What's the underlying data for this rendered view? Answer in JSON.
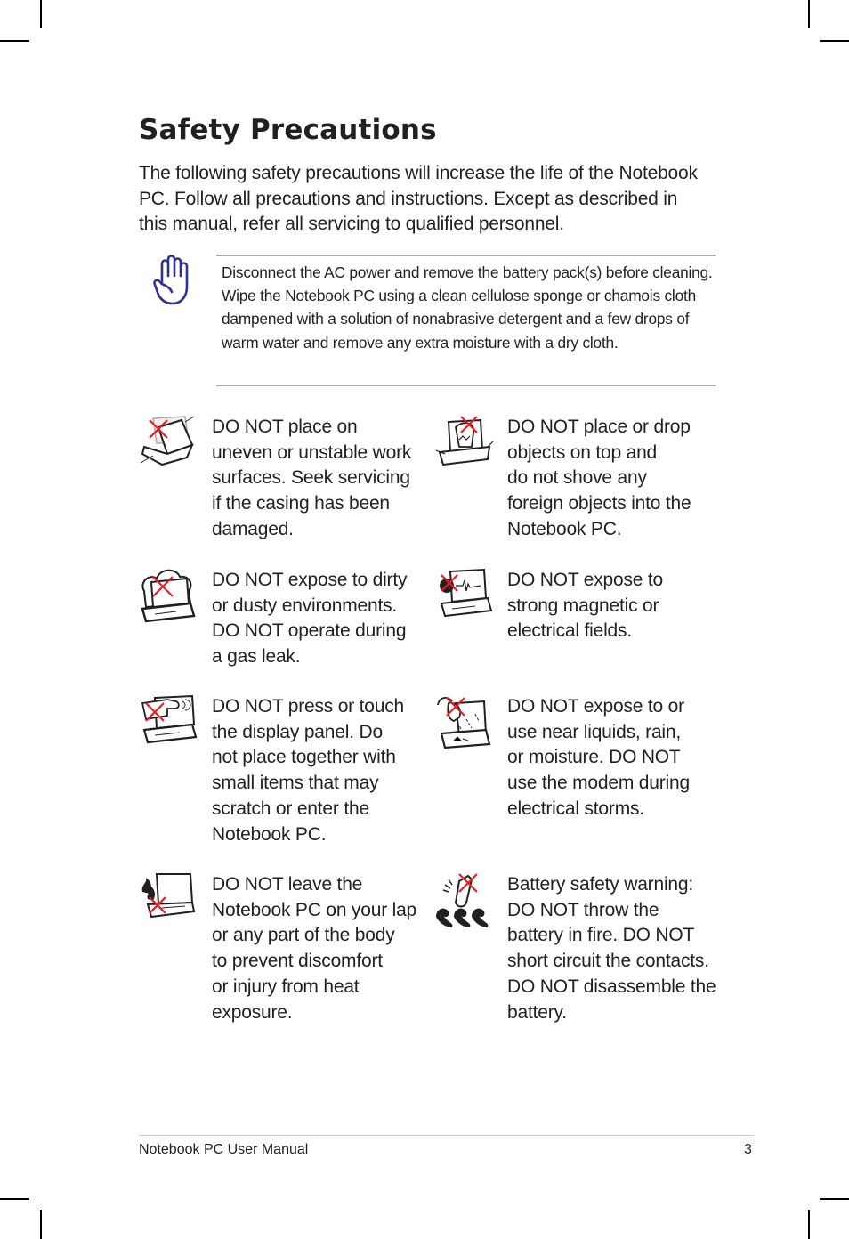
{
  "page": {
    "title": "Safety Precautions",
    "intro": "The following safety precautions will increase the life of the Notebook PC. Follow all precautions and instructions. Except as described in this manual, refer all servicing to qualified personnel.",
    "note": {
      "icon": "raised-hand-icon",
      "text": "Disconnect the AC power and remove the battery pack(s) before cleaning. Wipe the Notebook PC using a clean cellulose sponge or chamois cloth dampened with a solution of nonabrasive detergent and a few drops of warm water and remove any extra moisture with a dry cloth."
    },
    "precautions": [
      {
        "icon": "unstable-surface-icon",
        "text": "DO NOT place on\nuneven or unstable work\nsurfaces. Seek servicing\nif the casing has been\ndamaged."
      },
      {
        "icon": "objects-on-top-icon",
        "text": "DO NOT place or drop\nobjects on top and\ndo not shove any\nforeign objects into the\nNotebook PC."
      },
      {
        "icon": "dusty-environment-icon",
        "text": "DO NOT expose to dirty\nor dusty environments.\nDO NOT operate during\na gas leak."
      },
      {
        "icon": "magnetic-field-icon",
        "text": "DO NOT expose to\nstrong magnetic or\nelectrical fields."
      },
      {
        "icon": "touch-display-icon",
        "text": "DO NOT press or touch\nthe display panel. Do\nnot place together with\nsmall items that may\nscratch or enter the\nNotebook PC."
      },
      {
        "icon": "liquid-spill-icon",
        "text": "DO NOT expose to or\nuse near liquids, rain,\nor moisture. DO NOT\nuse the modem during\nelectrical storms."
      },
      {
        "icon": "heat-on-lap-icon",
        "text": "DO NOT leave the\nNotebook PC on your lap\nor any part of the body\nto prevent discomfort\nor injury from heat\nexposure."
      },
      {
        "icon": "battery-fire-icon",
        "text": "Battery safety warning:\nDO NOT throw the\nbattery in fire. DO NOT\nshort circuit the contacts.\nDO NOT disassemble the\nbattery."
      }
    ]
  },
  "footer": {
    "manual_title": "Notebook PC User Manual",
    "page_number": "3"
  },
  "colors": {
    "text": "#231f20",
    "note_icon": "#2e3192",
    "prohibit_x": "#ed1c24",
    "rule": "#a7a9ac"
  }
}
